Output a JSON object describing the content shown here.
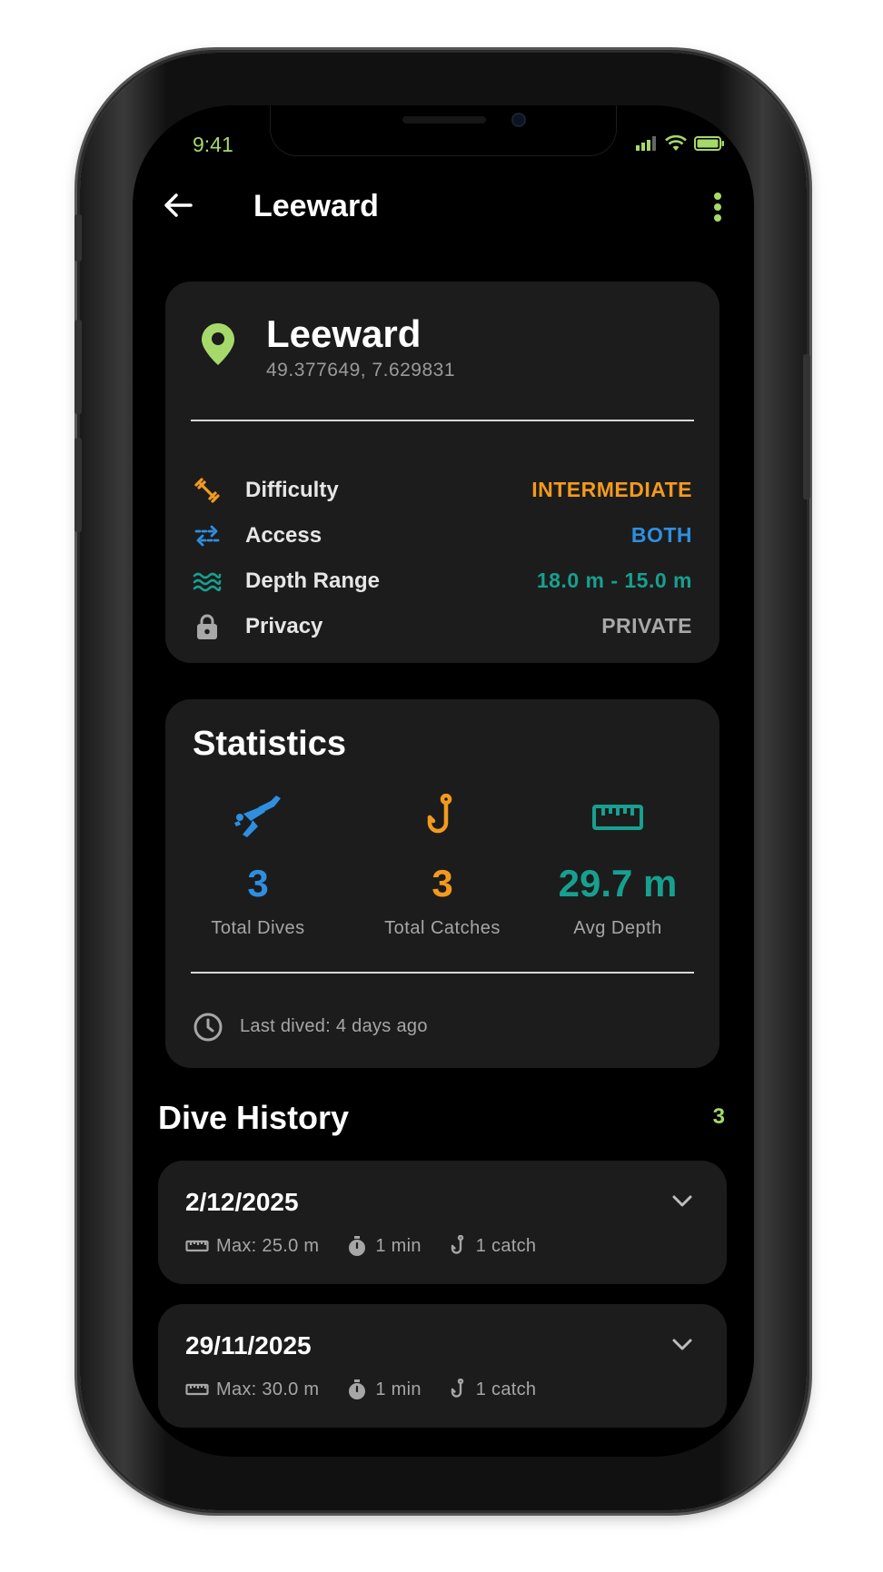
{
  "status_bar": {
    "time": "9:41"
  },
  "app_bar": {
    "title": "Leeward"
  },
  "location": {
    "name": "Leeward",
    "coordinates": "49.377649, 7.629831",
    "details": [
      {
        "label": "Difficulty",
        "value": "INTERMEDIATE",
        "color": "#f39a1e",
        "icon": "weight-icon"
      },
      {
        "label": "Access",
        "value": "BOTH",
        "color": "#2e8fe0",
        "icon": "swap-arrows-icon"
      },
      {
        "label": "Depth Range",
        "value": "18.0 m - 15.0 m",
        "color": "#17a08f",
        "icon": "waves-icon"
      },
      {
        "label": "Privacy",
        "value": "PRIVATE",
        "color": "#a8a8a8",
        "icon": "lock-icon"
      }
    ]
  },
  "statistics": {
    "title": "Statistics",
    "items": [
      {
        "value": "3",
        "label": "Total Dives",
        "color": "#2e8fe0",
        "icon": "diver-icon"
      },
      {
        "value": "3",
        "label": "Total Catches",
        "color": "#f39a1e",
        "icon": "fish-hook-icon"
      },
      {
        "value": "29.7 m",
        "label": "Avg Depth",
        "color": "#17a08f",
        "icon": "ruler-icon"
      }
    ],
    "last_dived": "Last dived: 4 days ago"
  },
  "dive_history": {
    "title": "Dive History",
    "count": "3",
    "dives": [
      {
        "date": "2/12/2025",
        "max_depth": "Max: 25.0 m",
        "duration": "1 min",
        "catches": "1 catch"
      },
      {
        "date": "29/11/2025",
        "max_depth": "Max: 30.0 m",
        "duration": "1 min",
        "catches": "1 catch"
      }
    ]
  },
  "colors": {
    "accent": "#a5d96a",
    "card": "#1c1c1c",
    "background": "#000000"
  }
}
